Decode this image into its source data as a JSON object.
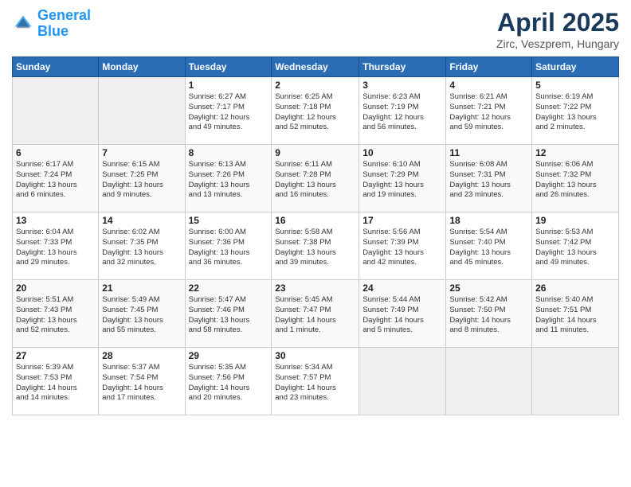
{
  "header": {
    "logo_line1": "General",
    "logo_line2": "Blue",
    "title": "April 2025",
    "subtitle": "Zirc, Veszprem, Hungary"
  },
  "columns": [
    "Sunday",
    "Monday",
    "Tuesday",
    "Wednesday",
    "Thursday",
    "Friday",
    "Saturday"
  ],
  "weeks": [
    [
      {
        "day": "",
        "info": ""
      },
      {
        "day": "",
        "info": ""
      },
      {
        "day": "1",
        "info": "Sunrise: 6:27 AM\nSunset: 7:17 PM\nDaylight: 12 hours\nand 49 minutes."
      },
      {
        "day": "2",
        "info": "Sunrise: 6:25 AM\nSunset: 7:18 PM\nDaylight: 12 hours\nand 52 minutes."
      },
      {
        "day": "3",
        "info": "Sunrise: 6:23 AM\nSunset: 7:19 PM\nDaylight: 12 hours\nand 56 minutes."
      },
      {
        "day": "4",
        "info": "Sunrise: 6:21 AM\nSunset: 7:21 PM\nDaylight: 12 hours\nand 59 minutes."
      },
      {
        "day": "5",
        "info": "Sunrise: 6:19 AM\nSunset: 7:22 PM\nDaylight: 13 hours\nand 2 minutes."
      }
    ],
    [
      {
        "day": "6",
        "info": "Sunrise: 6:17 AM\nSunset: 7:24 PM\nDaylight: 13 hours\nand 6 minutes."
      },
      {
        "day": "7",
        "info": "Sunrise: 6:15 AM\nSunset: 7:25 PM\nDaylight: 13 hours\nand 9 minutes."
      },
      {
        "day": "8",
        "info": "Sunrise: 6:13 AM\nSunset: 7:26 PM\nDaylight: 13 hours\nand 13 minutes."
      },
      {
        "day": "9",
        "info": "Sunrise: 6:11 AM\nSunset: 7:28 PM\nDaylight: 13 hours\nand 16 minutes."
      },
      {
        "day": "10",
        "info": "Sunrise: 6:10 AM\nSunset: 7:29 PM\nDaylight: 13 hours\nand 19 minutes."
      },
      {
        "day": "11",
        "info": "Sunrise: 6:08 AM\nSunset: 7:31 PM\nDaylight: 13 hours\nand 23 minutes."
      },
      {
        "day": "12",
        "info": "Sunrise: 6:06 AM\nSunset: 7:32 PM\nDaylight: 13 hours\nand 26 minutes."
      }
    ],
    [
      {
        "day": "13",
        "info": "Sunrise: 6:04 AM\nSunset: 7:33 PM\nDaylight: 13 hours\nand 29 minutes."
      },
      {
        "day": "14",
        "info": "Sunrise: 6:02 AM\nSunset: 7:35 PM\nDaylight: 13 hours\nand 32 minutes."
      },
      {
        "day": "15",
        "info": "Sunrise: 6:00 AM\nSunset: 7:36 PM\nDaylight: 13 hours\nand 36 minutes."
      },
      {
        "day": "16",
        "info": "Sunrise: 5:58 AM\nSunset: 7:38 PM\nDaylight: 13 hours\nand 39 minutes."
      },
      {
        "day": "17",
        "info": "Sunrise: 5:56 AM\nSunset: 7:39 PM\nDaylight: 13 hours\nand 42 minutes."
      },
      {
        "day": "18",
        "info": "Sunrise: 5:54 AM\nSunset: 7:40 PM\nDaylight: 13 hours\nand 45 minutes."
      },
      {
        "day": "19",
        "info": "Sunrise: 5:53 AM\nSunset: 7:42 PM\nDaylight: 13 hours\nand 49 minutes."
      }
    ],
    [
      {
        "day": "20",
        "info": "Sunrise: 5:51 AM\nSunset: 7:43 PM\nDaylight: 13 hours\nand 52 minutes."
      },
      {
        "day": "21",
        "info": "Sunrise: 5:49 AM\nSunset: 7:45 PM\nDaylight: 13 hours\nand 55 minutes."
      },
      {
        "day": "22",
        "info": "Sunrise: 5:47 AM\nSunset: 7:46 PM\nDaylight: 13 hours\nand 58 minutes."
      },
      {
        "day": "23",
        "info": "Sunrise: 5:45 AM\nSunset: 7:47 PM\nDaylight: 14 hours\nand 1 minute."
      },
      {
        "day": "24",
        "info": "Sunrise: 5:44 AM\nSunset: 7:49 PM\nDaylight: 14 hours\nand 5 minutes."
      },
      {
        "day": "25",
        "info": "Sunrise: 5:42 AM\nSunset: 7:50 PM\nDaylight: 14 hours\nand 8 minutes."
      },
      {
        "day": "26",
        "info": "Sunrise: 5:40 AM\nSunset: 7:51 PM\nDaylight: 14 hours\nand 11 minutes."
      }
    ],
    [
      {
        "day": "27",
        "info": "Sunrise: 5:39 AM\nSunset: 7:53 PM\nDaylight: 14 hours\nand 14 minutes."
      },
      {
        "day": "28",
        "info": "Sunrise: 5:37 AM\nSunset: 7:54 PM\nDaylight: 14 hours\nand 17 minutes."
      },
      {
        "day": "29",
        "info": "Sunrise: 5:35 AM\nSunset: 7:56 PM\nDaylight: 14 hours\nand 20 minutes."
      },
      {
        "day": "30",
        "info": "Sunrise: 5:34 AM\nSunset: 7:57 PM\nDaylight: 14 hours\nand 23 minutes."
      },
      {
        "day": "",
        "info": ""
      },
      {
        "day": "",
        "info": ""
      },
      {
        "day": "",
        "info": ""
      }
    ]
  ]
}
